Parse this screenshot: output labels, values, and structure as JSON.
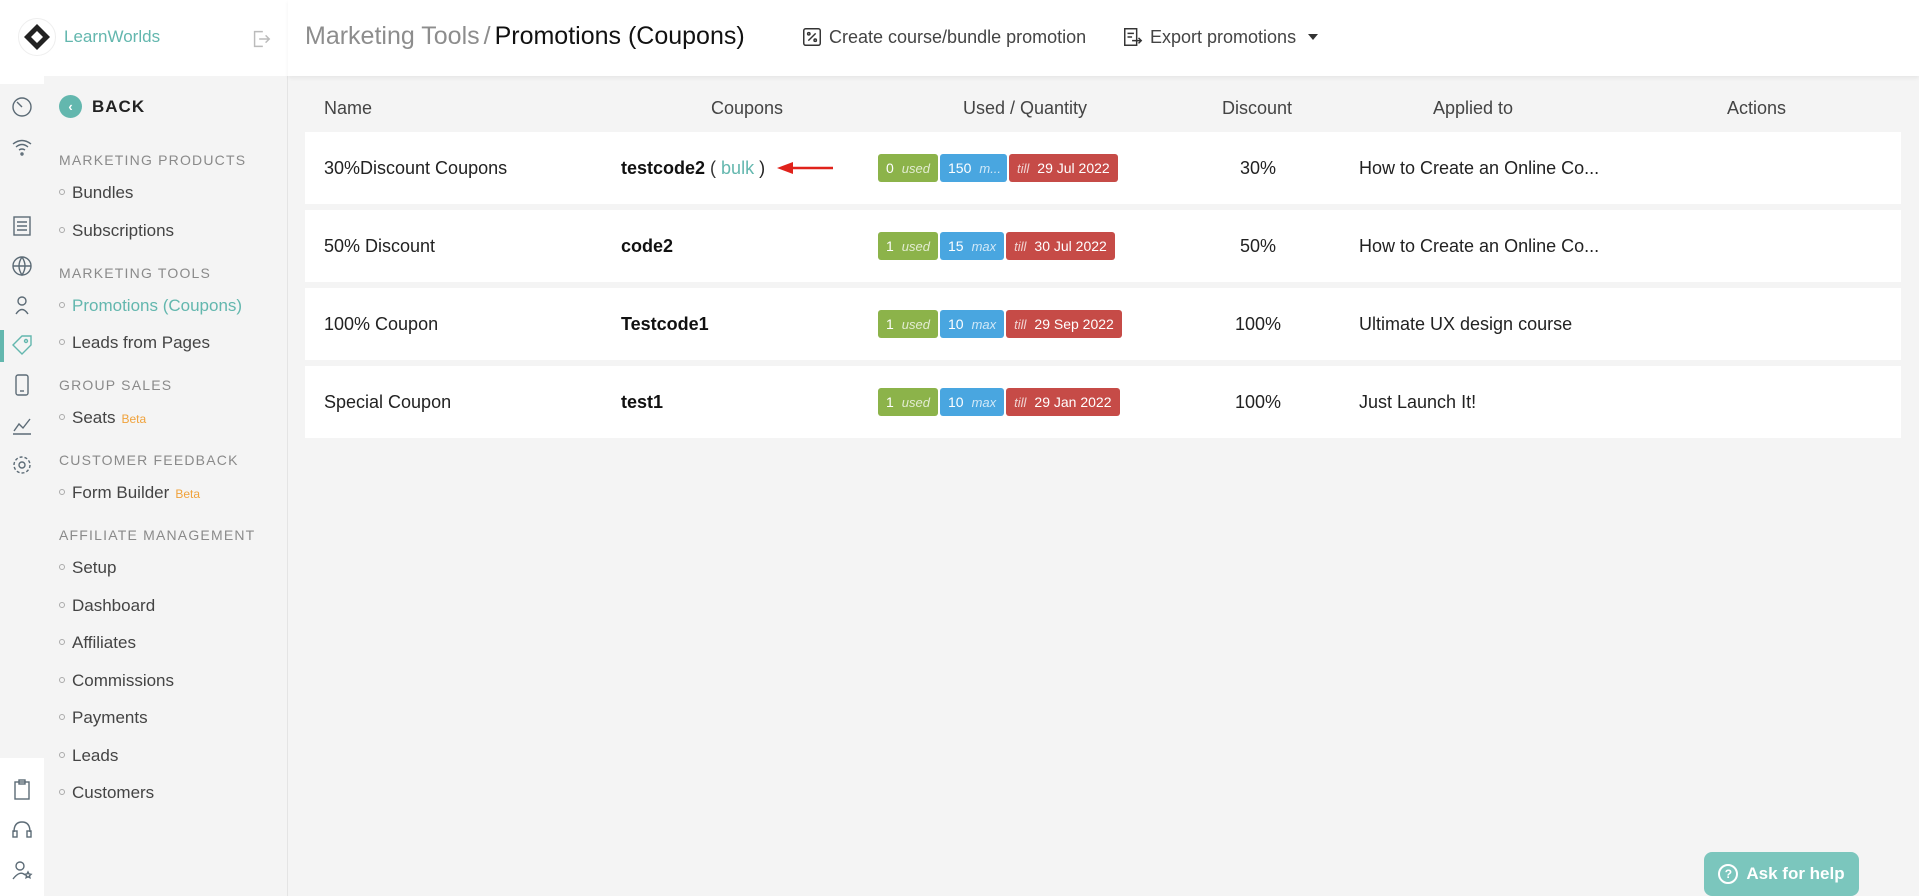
{
  "brand": {
    "name": "LearnWorlds"
  },
  "sidebar": {
    "back_label": "BACK",
    "sections": [
      {
        "title": "MARKETING PRODUCTS",
        "items": [
          {
            "label": "Bundles"
          },
          {
            "label": "Subscriptions"
          }
        ]
      },
      {
        "title": "MARKETING TOOLS",
        "items": [
          {
            "label": "Promotions (Coupons)",
            "active": true
          },
          {
            "label": "Leads from Pages"
          }
        ]
      },
      {
        "title": "GROUP SALES",
        "items": [
          {
            "label": "Seats",
            "badge": "Beta"
          }
        ]
      },
      {
        "title": "CUSTOMER FEEDBACK",
        "items": [
          {
            "label": "Form Builder",
            "badge": "Beta"
          }
        ]
      },
      {
        "title": "AFFILIATE MANAGEMENT",
        "items": [
          {
            "label": "Setup"
          },
          {
            "label": "Dashboard"
          },
          {
            "label": "Affiliates"
          },
          {
            "label": "Commissions"
          },
          {
            "label": "Payments"
          },
          {
            "label": "Leads"
          },
          {
            "label": "Customers"
          }
        ]
      }
    ]
  },
  "header": {
    "breadcrumb_parent": "Marketing Tools",
    "breadcrumb_sep": "/",
    "title": "Promotions (Coupons)",
    "create_label": "Create course/bundle promotion",
    "export_label": "Export promotions"
  },
  "table": {
    "columns": [
      "Name",
      "Coupons",
      "Used / Quantity",
      "Discount",
      "Applied to",
      "Actions"
    ],
    "rows": [
      {
        "name": "30%Discount Coupons",
        "coupon": "testcode2",
        "bulk": "bulk",
        "used": "0",
        "used_label": "used",
        "qty": "150",
        "qty_label": "m...",
        "till_label": "till",
        "till_date": "29 Jul 2022",
        "discount": "30%",
        "applied": "How to Create an Online Co..."
      },
      {
        "name": "50% Discount",
        "coupon": "code2",
        "used": "1",
        "used_label": "used",
        "qty": "15",
        "qty_label": "max",
        "till_label": "till",
        "till_date": "30 Jul 2022",
        "discount": "50%",
        "applied": "How to Create an Online Co..."
      },
      {
        "name": "100% Coupon",
        "coupon": "Testcode1",
        "used": "1",
        "used_label": "used",
        "qty": "10",
        "qty_label": "max",
        "till_label": "till",
        "till_date": "29 Sep 2022",
        "discount": "100%",
        "applied": "Ultimate UX design course"
      },
      {
        "name": "Special Coupon",
        "coupon": "test1",
        "used": "1",
        "used_label": "used",
        "qty": "10",
        "qty_label": "max",
        "till_label": "till",
        "till_date": "29 Jan 2022",
        "discount": "100%",
        "applied": "Just Launch It!"
      }
    ]
  },
  "help": {
    "label": "Ask for help"
  },
  "colors": {
    "accent": "#63b7ae",
    "used": "#8cb34a",
    "max": "#49a6e0",
    "till": "#c64b47",
    "beta": "#f0a23b",
    "arrow": "#e0221b"
  },
  "icons": [
    "speedometer-icon",
    "wifi-icon",
    "list-icon",
    "globe-icon",
    "person-icon",
    "tag-icon",
    "mobile-icon",
    "chart-icon",
    "gear-icon",
    "clipboard-icon",
    "headset-icon",
    "user-star-icon"
  ]
}
